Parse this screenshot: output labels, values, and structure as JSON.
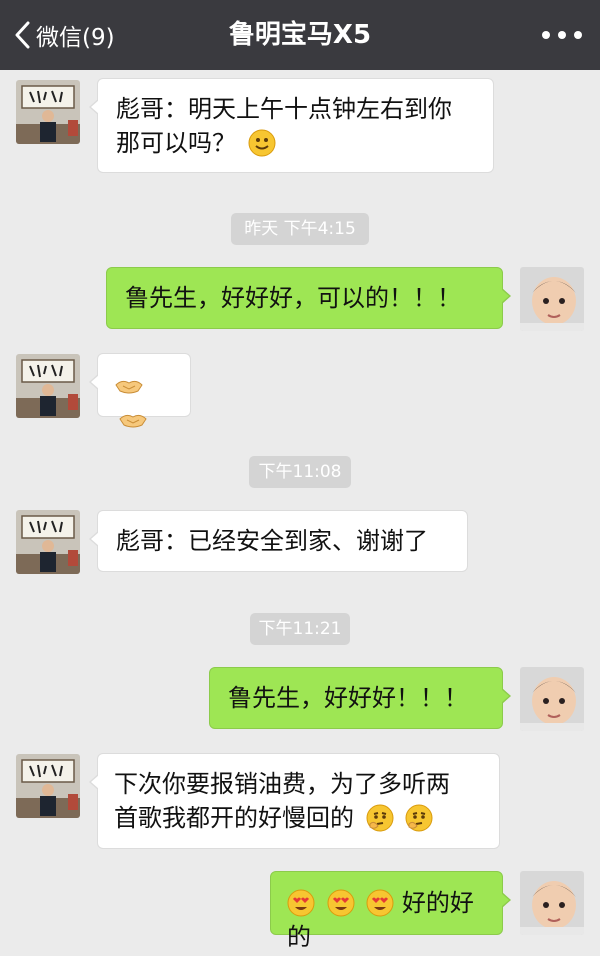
{
  "app": {
    "back_label": "微信(9)",
    "title": "鲁明宝马X5"
  },
  "messages": [
    {
      "side": "left",
      "text": "彪哥：明天上午十点钟左右到你",
      "text2": "那可以吗？",
      "emoji": [
        "smile-emoji"
      ]
    },
    {
      "type": "timestamp",
      "text": "昨天 下午4:15"
    },
    {
      "side": "right",
      "text": "鲁先生，好好好，可以的！！！"
    },
    {
      "side": "left",
      "text": "",
      "emoji": [
        "handshake-emoji",
        "handshake-emoji"
      ]
    },
    {
      "type": "timestamp",
      "text": "下午11:08"
    },
    {
      "side": "left",
      "text": "彪哥：已经安全到家、谢谢了"
    },
    {
      "type": "timestamp",
      "text": "下午11:21"
    },
    {
      "side": "right",
      "text": "鲁先生，好好好！！！"
    },
    {
      "side": "left",
      "text": " 下次你要报销油费，为了多听两",
      "text2": "首歌我都开的好慢回的",
      "emoji": [
        "thinking-emoji",
        "thinking-emoji"
      ]
    },
    {
      "side": "right",
      "text": "好的好的",
      "emoji": [
        "heart-eyes-emoji",
        "heart-eyes-emoji",
        "heart-eyes-emoji"
      ]
    }
  ],
  "colors": {
    "navbar": "#3a3a3f",
    "background": "#ebebeb",
    "bubble_right": "#9ee654",
    "bubble_left": "#ffffff",
    "timestamp_bg": "#d4d4d4"
  }
}
